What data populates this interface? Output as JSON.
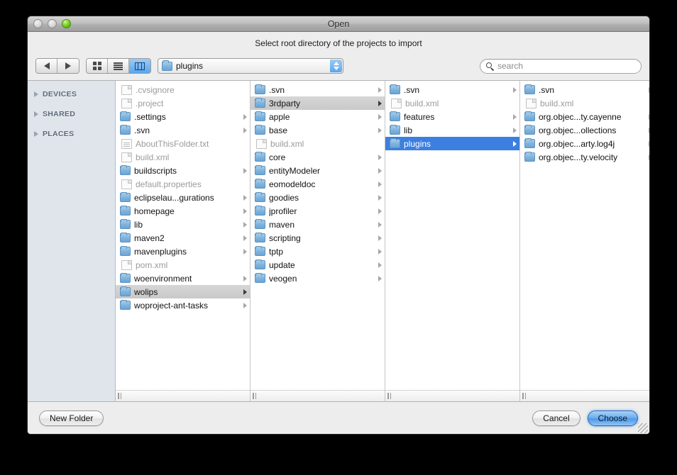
{
  "window": {
    "title": "Open",
    "prompt": "Select root directory of the projects to import"
  },
  "toolbar": {
    "back_icon": "back-arrow-icon",
    "forward_icon": "forward-arrow-icon",
    "view_icon_grid": "icon-view-icon",
    "view_icon_list": "list-view-icon",
    "view_icon_column": "column-view-icon",
    "path_value": "plugins",
    "search_placeholder": "search"
  },
  "sidebar": {
    "groups": [
      {
        "label": "DEVICES"
      },
      {
        "label": "SHARED"
      },
      {
        "label": "PLACES"
      }
    ]
  },
  "columns": [
    {
      "items": [
        {
          "name": ".cvsignore",
          "type": "file",
          "disabled": true,
          "chevron": false,
          "selected": "none"
        },
        {
          "name": ".project",
          "type": "file",
          "disabled": true,
          "chevron": false,
          "selected": "none"
        },
        {
          "name": ".settings",
          "type": "folder",
          "disabled": false,
          "chevron": true,
          "selected": "none"
        },
        {
          "name": ".svn",
          "type": "folder",
          "disabled": false,
          "chevron": true,
          "selected": "none"
        },
        {
          "name": "AboutThisFolder.txt",
          "type": "doc",
          "disabled": true,
          "chevron": false,
          "selected": "none"
        },
        {
          "name": "build.xml",
          "type": "file",
          "disabled": true,
          "chevron": false,
          "selected": "none"
        },
        {
          "name": "buildscripts",
          "type": "folder",
          "disabled": false,
          "chevron": true,
          "selected": "none"
        },
        {
          "name": "default.properties",
          "type": "file",
          "disabled": true,
          "chevron": false,
          "selected": "none"
        },
        {
          "name": "eclipselau...gurations",
          "type": "folder",
          "disabled": false,
          "chevron": true,
          "selected": "none"
        },
        {
          "name": "homepage",
          "type": "folder",
          "disabled": false,
          "chevron": true,
          "selected": "none"
        },
        {
          "name": "lib",
          "type": "folder",
          "disabled": false,
          "chevron": true,
          "selected": "none"
        },
        {
          "name": "maven2",
          "type": "folder",
          "disabled": false,
          "chevron": true,
          "selected": "none"
        },
        {
          "name": "mavenplugins",
          "type": "folder",
          "disabled": false,
          "chevron": true,
          "selected": "none"
        },
        {
          "name": "pom.xml",
          "type": "file",
          "disabled": true,
          "chevron": false,
          "selected": "none"
        },
        {
          "name": "woenvironment",
          "type": "folder",
          "disabled": false,
          "chevron": true,
          "selected": "none"
        },
        {
          "name": "wolips",
          "type": "folder",
          "disabled": false,
          "chevron": true,
          "selected": "inactive"
        },
        {
          "name": "woproject-ant-tasks",
          "type": "folder",
          "disabled": false,
          "chevron": true,
          "selected": "none"
        }
      ]
    },
    {
      "items": [
        {
          "name": ".svn",
          "type": "folder",
          "disabled": false,
          "chevron": true,
          "selected": "none"
        },
        {
          "name": "3rdparty",
          "type": "folder",
          "disabled": false,
          "chevron": true,
          "selected": "inactive"
        },
        {
          "name": "apple",
          "type": "folder",
          "disabled": false,
          "chevron": true,
          "selected": "none"
        },
        {
          "name": "base",
          "type": "folder",
          "disabled": false,
          "chevron": true,
          "selected": "none"
        },
        {
          "name": "build.xml",
          "type": "file",
          "disabled": true,
          "chevron": false,
          "selected": "none"
        },
        {
          "name": "core",
          "type": "folder",
          "disabled": false,
          "chevron": true,
          "selected": "none"
        },
        {
          "name": "entityModeler",
          "type": "folder",
          "disabled": false,
          "chevron": true,
          "selected": "none"
        },
        {
          "name": "eomodeldoc",
          "type": "folder",
          "disabled": false,
          "chevron": true,
          "selected": "none"
        },
        {
          "name": "goodies",
          "type": "folder",
          "disabled": false,
          "chevron": true,
          "selected": "none"
        },
        {
          "name": "jprofiler",
          "type": "folder",
          "disabled": false,
          "chevron": true,
          "selected": "none"
        },
        {
          "name": "maven",
          "type": "folder",
          "disabled": false,
          "chevron": true,
          "selected": "none"
        },
        {
          "name": "scripting",
          "type": "folder",
          "disabled": false,
          "chevron": true,
          "selected": "none"
        },
        {
          "name": "tptp",
          "type": "folder",
          "disabled": false,
          "chevron": true,
          "selected": "none"
        },
        {
          "name": "update",
          "type": "folder",
          "disabled": false,
          "chevron": true,
          "selected": "none"
        },
        {
          "name": "veogen",
          "type": "folder",
          "disabled": false,
          "chevron": true,
          "selected": "none"
        }
      ]
    },
    {
      "items": [
        {
          "name": ".svn",
          "type": "folder",
          "disabled": false,
          "chevron": true,
          "selected": "none"
        },
        {
          "name": "build.xml",
          "type": "file",
          "disabled": true,
          "chevron": false,
          "selected": "none"
        },
        {
          "name": "features",
          "type": "folder",
          "disabled": false,
          "chevron": true,
          "selected": "none"
        },
        {
          "name": "lib",
          "type": "folder",
          "disabled": false,
          "chevron": true,
          "selected": "none"
        },
        {
          "name": "plugins",
          "type": "folder",
          "disabled": false,
          "chevron": true,
          "selected": "active"
        }
      ]
    },
    {
      "items": [
        {
          "name": ".svn",
          "type": "folder",
          "disabled": false,
          "chevron": true,
          "selected": "none"
        },
        {
          "name": "build.xml",
          "type": "file",
          "disabled": true,
          "chevron": false,
          "selected": "none"
        },
        {
          "name": "org.objec...ty.cayenne",
          "type": "folder",
          "disabled": false,
          "chevron": true,
          "selected": "none"
        },
        {
          "name": "org.objec...ollections",
          "type": "folder",
          "disabled": false,
          "chevron": true,
          "selected": "none"
        },
        {
          "name": "org.objec...arty.log4j",
          "type": "folder",
          "disabled": false,
          "chevron": true,
          "selected": "none"
        },
        {
          "name": "org.objec...ty.velocity",
          "type": "folder",
          "disabled": false,
          "chevron": true,
          "selected": "none"
        }
      ]
    }
  ],
  "footer": {
    "new_folder_label": "New Folder",
    "cancel_label": "Cancel",
    "choose_label": "Choose"
  },
  "colors": {
    "selection_active": "#3d7fe0",
    "selection_inactive": "#d0d0d0",
    "window_chrome": "#ededed",
    "sidebar": "#e0e5ec"
  }
}
